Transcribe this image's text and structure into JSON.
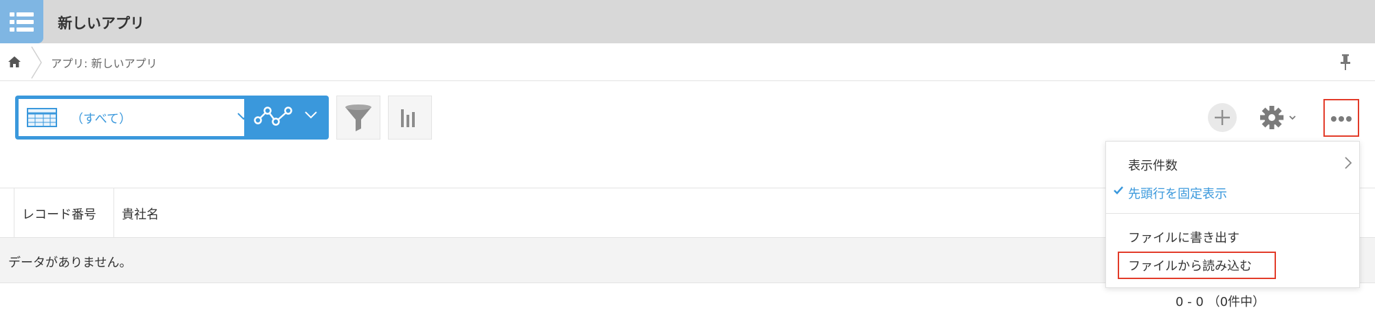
{
  "header": {
    "app_title": "新しいアプリ",
    "app_icon": "list-icon"
  },
  "breadcrumb": {
    "home_icon": "home-icon",
    "path": "アプリ: 新しいアプリ",
    "pin_icon": "pin-icon"
  },
  "toolbar": {
    "view_label": "（すべて）",
    "view_icon": "table-icon",
    "graph_icon": "graph-icon",
    "filter_icon": "filter-icon",
    "chart_icon": "bar-chart-icon",
    "add_icon": "plus-icon",
    "settings_icon": "gear-icon",
    "more_icon": "more-icon",
    "accent_color": "#3a98dc",
    "highlight_color": "#e23a28"
  },
  "table": {
    "columns": [
      "レコード番号",
      "貴社名"
    ],
    "empty_message": "データがありません。",
    "pager": "0 - 0 （0件中）"
  },
  "menu": {
    "items": [
      {
        "label": "表示件数",
        "submenu": true
      },
      {
        "label": "先頭行を固定表示",
        "checked": true
      },
      {
        "label": "ファイルに書き出す"
      },
      {
        "label": "ファイルから読み込む",
        "highlighted": true
      }
    ]
  }
}
